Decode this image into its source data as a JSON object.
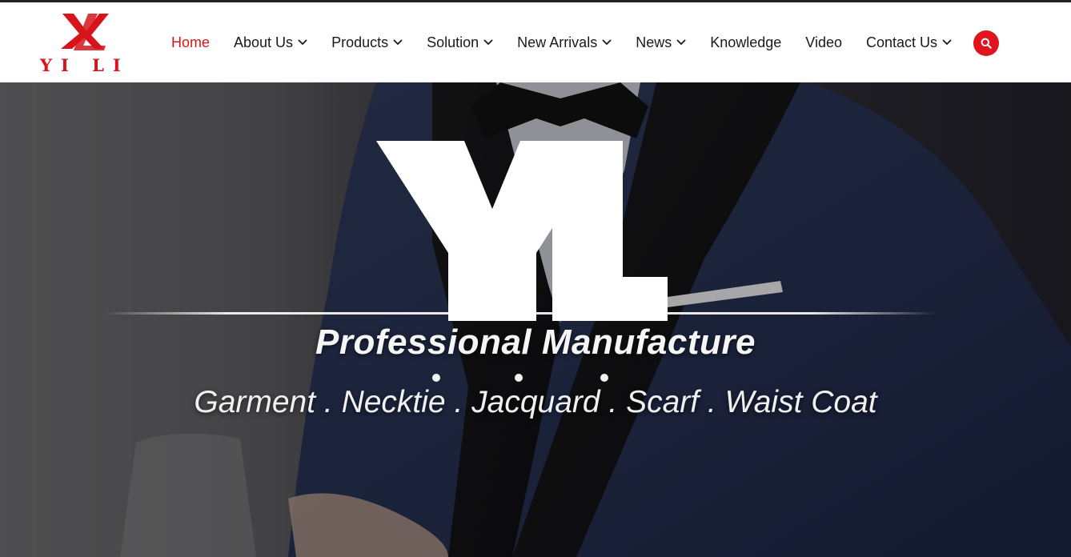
{
  "brand": {
    "logo_text": "YI LI",
    "primary_color": "#d7141b"
  },
  "nav": {
    "items": [
      {
        "label": "Home",
        "active": true,
        "has_dropdown": false
      },
      {
        "label": "About Us",
        "active": false,
        "has_dropdown": true
      },
      {
        "label": "Products",
        "active": false,
        "has_dropdown": true
      },
      {
        "label": "Solution",
        "active": false,
        "has_dropdown": true
      },
      {
        "label": "New Arrivals",
        "active": false,
        "has_dropdown": true
      },
      {
        "label": "News",
        "active": false,
        "has_dropdown": true
      },
      {
        "label": "Knowledge",
        "active": false,
        "has_dropdown": false
      },
      {
        "label": "Video",
        "active": false,
        "has_dropdown": false
      },
      {
        "label": "Contact Us",
        "active": false,
        "has_dropdown": true
      }
    ],
    "search_icon": "search-icon"
  },
  "hero": {
    "big_mark": "YL",
    "tagline": "Professional Manufacture",
    "products_line": "Garment . Necktie . Jacquard . Scarf . Waist Coat",
    "background": "man in navy tuxedo with black bow tie"
  }
}
